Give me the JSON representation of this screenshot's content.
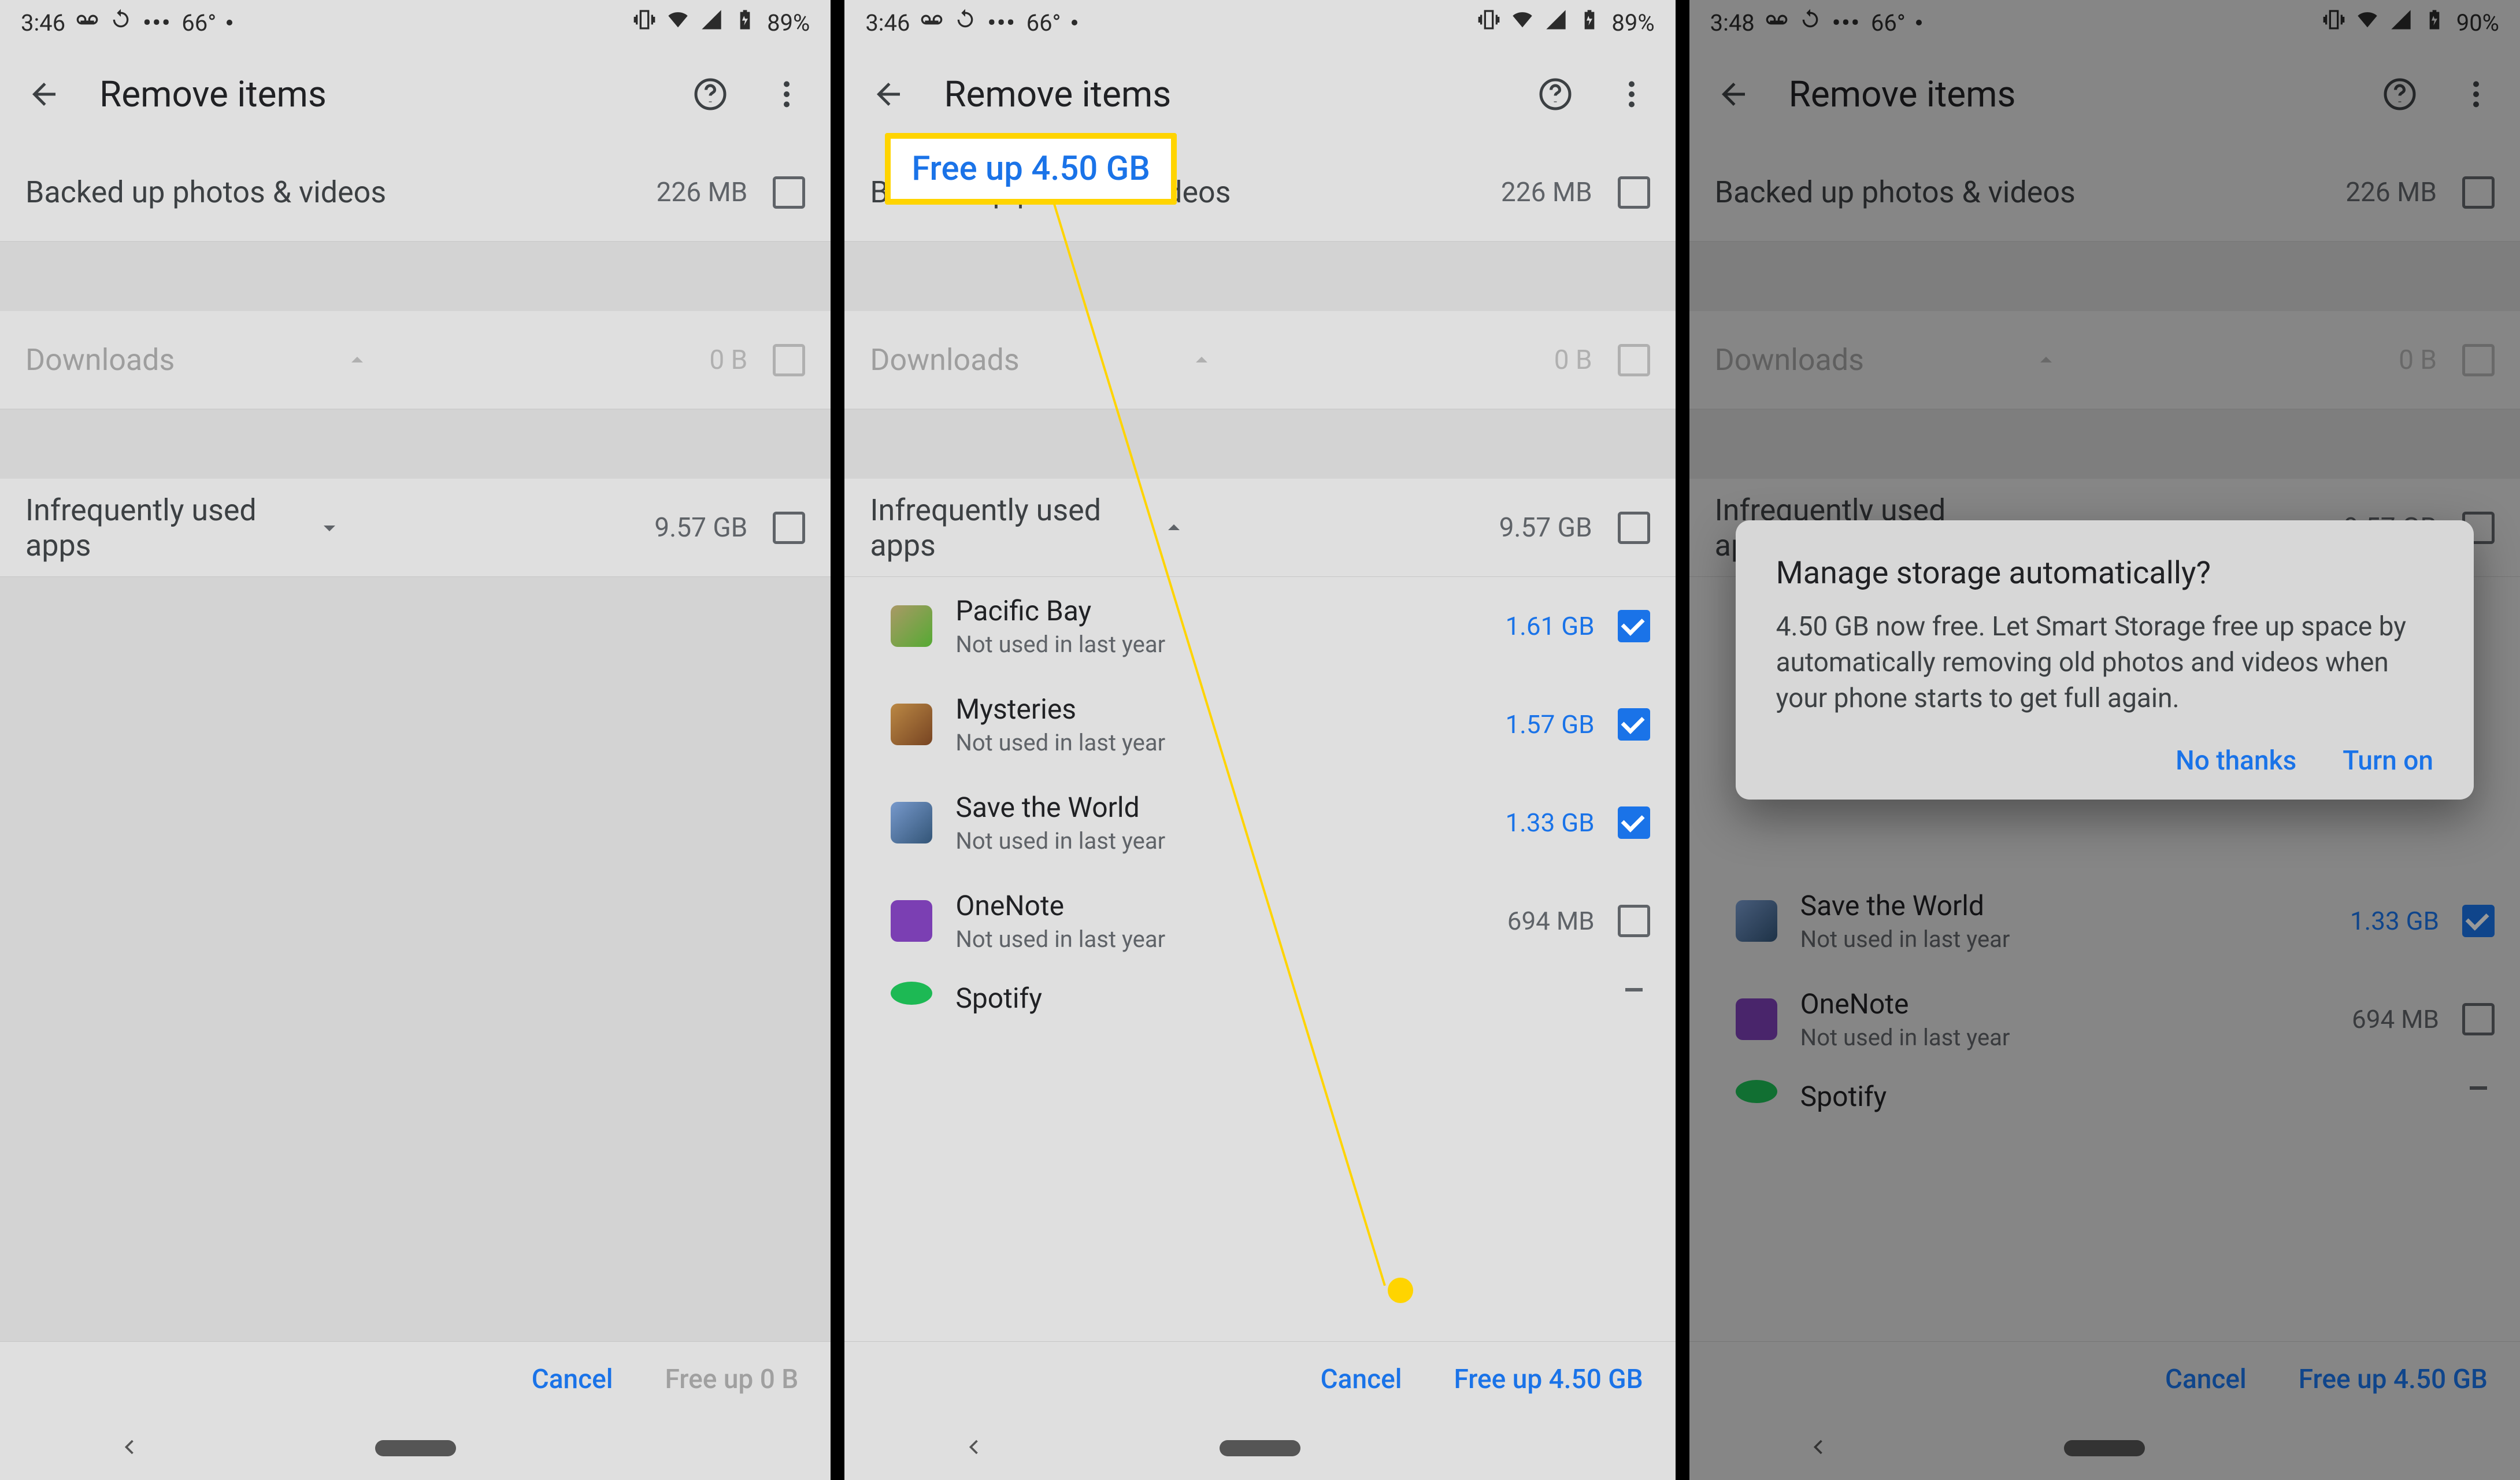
{
  "screens": [
    {
      "statusbar": {
        "time": "3:46",
        "temp": "66°",
        "battery": "89%"
      },
      "appbar": {
        "title": "Remove items"
      },
      "categories": {
        "backed_up": {
          "label": "Backed up photos & videos",
          "size": "226 MB",
          "checked": false
        },
        "downloads": {
          "label": "Downloads",
          "size": "0 B",
          "checked": false,
          "disabled": true,
          "expanded": false
        },
        "apps_header": {
          "label": "Infrequently used apps",
          "size": "9.57 GB",
          "checked": false,
          "expanded": false
        }
      },
      "actions": {
        "cancel": "Cancel",
        "free": "Free up 0 B",
        "free_disabled": true
      }
    },
    {
      "statusbar": {
        "time": "3:46",
        "temp": "66°",
        "battery": "89%"
      },
      "appbar": {
        "title": "Remove items"
      },
      "categories": {
        "backed_up": {
          "label": "Backed up photos & videos",
          "size": "226 MB",
          "checked": false
        },
        "downloads": {
          "label": "Downloads",
          "size": "0 B",
          "checked": false,
          "disabled": true,
          "expanded": false
        },
        "apps_header": {
          "label": "Infrequently used apps",
          "size": "9.57 GB",
          "checked": false,
          "expanded": true
        }
      },
      "apps": [
        {
          "name": "Pacific Bay",
          "sub": "Not used in last year",
          "size": "1.61 GB",
          "checked": true
        },
        {
          "name": "Mysteries",
          "sub": "Not used in last year",
          "size": "1.57 GB",
          "checked": true
        },
        {
          "name": "Save the World",
          "sub": "Not used in last year",
          "size": "1.33 GB",
          "checked": true
        },
        {
          "name": "OneNote",
          "sub": "Not used in last year",
          "size": "694 MB",
          "checked": false
        },
        {
          "name": "Spotify",
          "sub": "",
          "size": "",
          "checked": "minus"
        }
      ],
      "actions": {
        "cancel": "Cancel",
        "free": "Free up 4.50 GB",
        "free_disabled": false
      },
      "annotation": {
        "label": "Free up 4.50 GB"
      }
    },
    {
      "statusbar": {
        "time": "3:48",
        "temp": "66°",
        "battery": "90%"
      },
      "appbar": {
        "title": "Remove items"
      },
      "categories": {
        "backed_up": {
          "label": "Backed up photos & videos",
          "size": "226 MB",
          "checked": false
        },
        "downloads": {
          "label": "Downloads",
          "size": "0 B",
          "checked": false,
          "disabled": true,
          "expanded": false
        },
        "apps_header": {
          "label": "Infrequently used apps",
          "size": "9.57 GB",
          "checked": false,
          "expanded": true
        }
      },
      "apps": [
        {
          "name": "Save the World",
          "sub": "Not used in last year",
          "size": "1.33 GB",
          "checked": true
        },
        {
          "name": "OneNote",
          "sub": "Not used in last year",
          "size": "694 MB",
          "checked": false
        },
        {
          "name": "Spotify",
          "sub": "",
          "size": "",
          "checked": "minus"
        }
      ],
      "actions": {
        "cancel": "Cancel",
        "free": "Free up 4.50 GB",
        "free_disabled": false
      },
      "dialog": {
        "title": "Manage storage automatically?",
        "body": "4.50 GB now free. Let Smart Storage free up space by automatically removing old photos and videos when your phone starts to get full again.",
        "no": "No thanks",
        "turn_on": "Turn on"
      }
    }
  ]
}
